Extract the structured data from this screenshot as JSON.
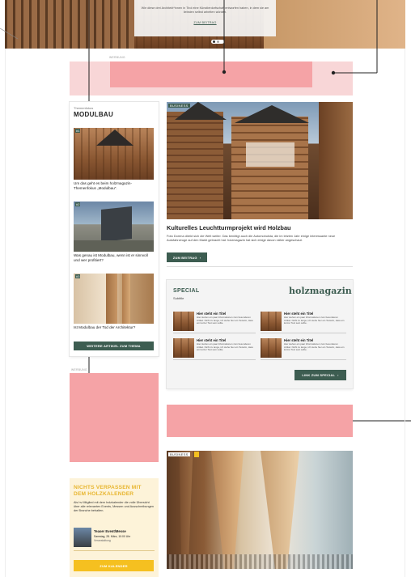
{
  "hero": {
    "text": "Wie diese drei Architekt*innen in Tirol eine Künstlerdorfschaft entworfen haben, in dem sie am liebsten selbst arbeiten würden.",
    "button": "ZUM BEITRAG"
  },
  "ad_top": {
    "label": "WERBUNG"
  },
  "focus": {
    "kicker": "Themenfokus",
    "title": "MODULBAU",
    "items": [
      {
        "num": "#1",
        "text": "Um das geht es beim holzmagazin-Themenfokus „Modulbau“."
      },
      {
        "num": "#2",
        "text": "Was genau ist Modulbau, wenn ist er sinnvoll und wer profitiert?"
      },
      {
        "num": "#3",
        "text": "Ist Modulbau der Tod der Architektur?"
      }
    ],
    "button": "WEITERE ARTIKEL ZUM THEMA"
  },
  "feature": {
    "tag": "BUSINESS",
    "title": "Kulturelles Leuchtturmprojekt wird Holzbau",
    "body": "Foto Dorena direkt sich die Welt weiter. Das benötigt auch die Automobulsta, die im letzten Jahr einige interessante neue Autofahrzeuge auf den Markt gebracht hat. holzmagazin hat sich einige davon näher angeschaut.",
    "button": "ZUM BEITRAG"
  },
  "special": {
    "title": "SPECIAL",
    "subtitle": "Subtitle",
    "logo": "holzmagazin",
    "items": [
      {
        "title": "Hier steht ein Titel",
        "text": "Hier stehen ein paar Informationen zum besonderen Artikel. Nicht zu lange, ich stehe hier ein Textelm, dass ein kurzer Text sein sollte."
      },
      {
        "title": "Hier steht ein Titel",
        "text": "Hier stehen ein paar Informationen zum besonderen Artikel. Nicht zu lange, ich stehe hier ein Textelm, dass ein kurzer Text sein sollte."
      },
      {
        "title": "Hier steht ein Titel",
        "text": "Hier stehen ein paar Informationen zum besonderen Artikel. Nicht zu lange, ich stehe hier ein Textelm, dass ein kurzer Text sein sollte."
      },
      {
        "title": "Hier steht ein Titel",
        "text": "Hier stehen ein paar Informationen zum besonderen Artikel. Nicht zu lange, ich stehe hier ein Textelm, dass ein kurzer Text sein sollte."
      }
    ],
    "button": "LINK ZUM SPECIAL"
  },
  "ad_side": {
    "label": "WERBUNG"
  },
  "calendar": {
    "title": "NICHTS VERPASSEN MIT DEM HOLZKALENDER",
    "text": "Als hv Mitglied mit dem holzkalender die volle Übersicht über alle relevanten Events, Messen und Ausschreibungen der Branche behalten.",
    "event_title": "Teaser Event/Messe",
    "event_date": "Samstag, 28. März, 10:00 Uhr",
    "event_place": "Veranstaltung",
    "button": "ZUM KALENDER"
  },
  "bottom_article": {
    "tag": "BUSINESS"
  },
  "colors": {
    "green": "#3d5d51",
    "ad_pink": "#f5a3a6",
    "ad_light": "#f8d6d7",
    "calendar_bg": "#fdf3d9",
    "calendar_accent": "#e8b630",
    "button_yellow": "#f5c020"
  }
}
